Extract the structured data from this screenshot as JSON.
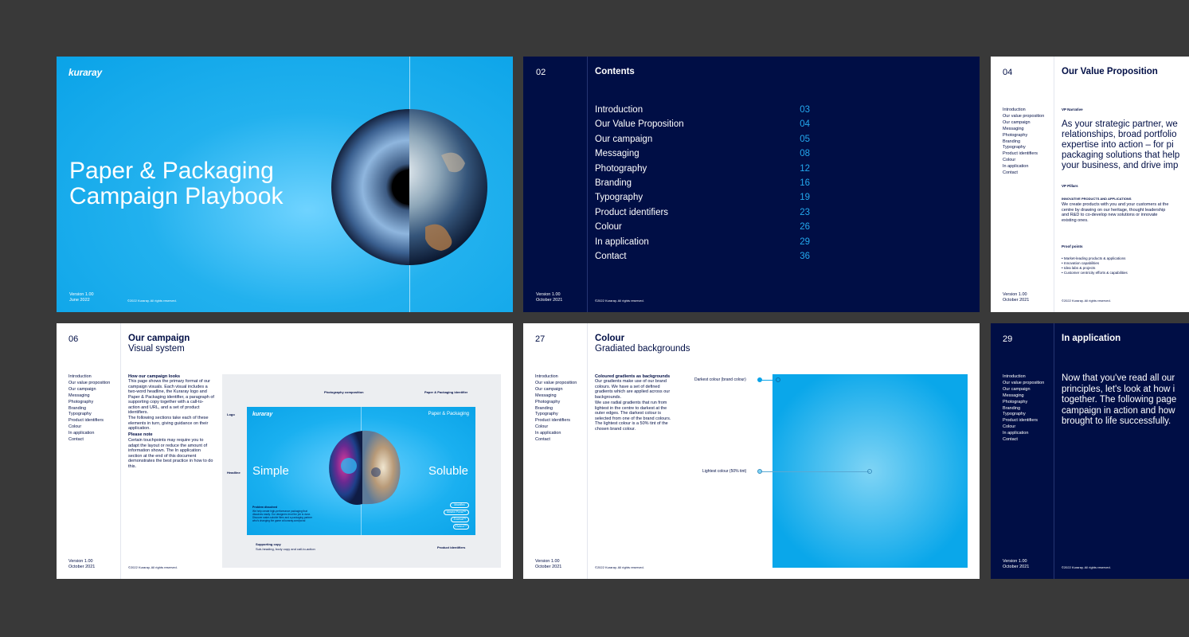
{
  "cover": {
    "logo": "kuraray",
    "title_line1": "Paper & Packaging",
    "title_line2": "Campaign Playbook",
    "version": "Version 1.00",
    "date": "June 2022",
    "copyright": "©2022 Kuraray. All rights reserved."
  },
  "contents_page": {
    "page": "02",
    "title": "Contents",
    "items": [
      {
        "label": "Introduction",
        "page": "03"
      },
      {
        "label": "Our Value Proposition",
        "page": "04"
      },
      {
        "label": "Our campaign",
        "page": "05"
      },
      {
        "label": "Messaging",
        "page": "08"
      },
      {
        "label": "Photography",
        "page": "12"
      },
      {
        "label": "Branding",
        "page": "16"
      },
      {
        "label": "Typography",
        "page": "19"
      },
      {
        "label": "Product identifiers",
        "page": "23"
      },
      {
        "label": "Colour",
        "page": "26"
      },
      {
        "label": "In application",
        "page": "29"
      },
      {
        "label": "Contact",
        "page": "36"
      }
    ],
    "version": "Version 1.00",
    "date": "October 2021",
    "copyright": "©2022 Kuraray. All rights reserved."
  },
  "nav": [
    "Introduction",
    "Our value proposition",
    "Our campaign",
    "Messaging",
    "Photography",
    "Branding",
    "Typography",
    "Product identifiers",
    "Colour",
    "In application",
    "Contact"
  ],
  "value_page": {
    "page": "04",
    "title": "Our Value Proposition",
    "vp_narrative_label": "VP Narrative",
    "narrative_lines": [
      "As your strategic partner, we",
      "relationships, broad portfolio",
      "expertise into action – for pi",
      "packaging solutions that help",
      "your business, and drive imp"
    ],
    "vp_pillars_label": "VP Pillars",
    "pillar_heading": "INNOVATIVE PRODUCTS AND APPLICATIONS",
    "pillar_body": "We create products with you and your customers at the centre by drawing on our heritage, thought leadership and R&D to co-develop new solutions or innovate existing ones.",
    "proof_label": "Proof points",
    "proof_points": [
      "Market-leading products & applications",
      "Innovation capabilities",
      "Idea labs & projects",
      "Customer centricity efforts & capabilities"
    ],
    "version": "Version 1.00",
    "date": "October 2021",
    "copyright": "©2022 Kuraray. All rights reserved."
  },
  "campaign_page": {
    "page": "06",
    "title": "Our campaign",
    "subtitle": "Visual system",
    "heading": "How our campaign looks",
    "body1": "This page shows the primary format of our campaign visuals. Each visual includes a two-word headline, the Kuraray logo and Paper & Packaging identifier, a paragraph of supporting copy together with a call-to-action and URL, and a set of product identifiers.",
    "body2": "The following sections take each of these elements in turn, giving guidance on their application.",
    "note_heading": "Please note",
    "note_body": "Certain touchpoints may require you to adapt the layout or reduce the amount of information shown. The In application section at the end of this document demonstrates the best practice in how to do this.",
    "labels": {
      "photo": "Photography composition",
      "identifier": "Paper & Packaging identifier",
      "logo": "Logo",
      "headline": "Headline",
      "supporting": "Supporting copy",
      "supporting_sub": "Sub-heading, body copy and call-to-action",
      "product": "Product identifiers"
    },
    "visual": {
      "logo": "kuraray",
      "identifier": "Paper & Packaging",
      "word1": "Simple",
      "word2": "Soluble",
      "copy_heading": "Problem dissolved",
      "copy_body": "We help create high-performance packaging that dissolves easily. Our designers lend the job is done. Discover water-soluble films and a packaging partner who's changing the game at kuraray.com/poval",
      "pills": [
        "Mowiflex",
        "Mowiol Poval™",
        "Exceval™",
        "Elvanol™"
      ]
    },
    "version": "Version 1.00",
    "date": "October 2021",
    "copyright": "©2022 Kuraray. All rights reserved."
  },
  "colour_page": {
    "page": "27",
    "title": "Colour",
    "subtitle": "Gradiated backgrounds",
    "heading": "Coloured gradients as backgrounds",
    "body1": "Our gradients make use of our brand colours. We have a set of defined gradients which are applied across our backgrounds.",
    "body2": "We use radial gradients that run from lightest in the centre to darkest at the outer edges. The darkest colour is selected from one of the brand colours. The lightest colour is a 50% tint of the chosen brand colour.",
    "darkest_label": "Darkest colour (brand colour)",
    "lightest_label": "Lightest colour (50% tint)",
    "darkest_color": "#0aa7ea",
    "lightest_color": "#7fd4f5",
    "version": "Version 1.00",
    "date": "October 2021",
    "copyright": "©2022 Kuraray. All rights reserved."
  },
  "application_page": {
    "page": "29",
    "title": "In application",
    "body_lines": [
      "Now that you've read all our",
      "principles, let's look at how i",
      "together. The following page",
      "campaign in action and how",
      "brought to life successfully."
    ],
    "version": "Version 1.00",
    "date": "October 2021",
    "copyright": "©2022 Kuraray. All rights reserved."
  },
  "colors": {
    "navy": "#000e45",
    "cyan": "#0aa3e8",
    "accent_number": "#23a8ee"
  }
}
